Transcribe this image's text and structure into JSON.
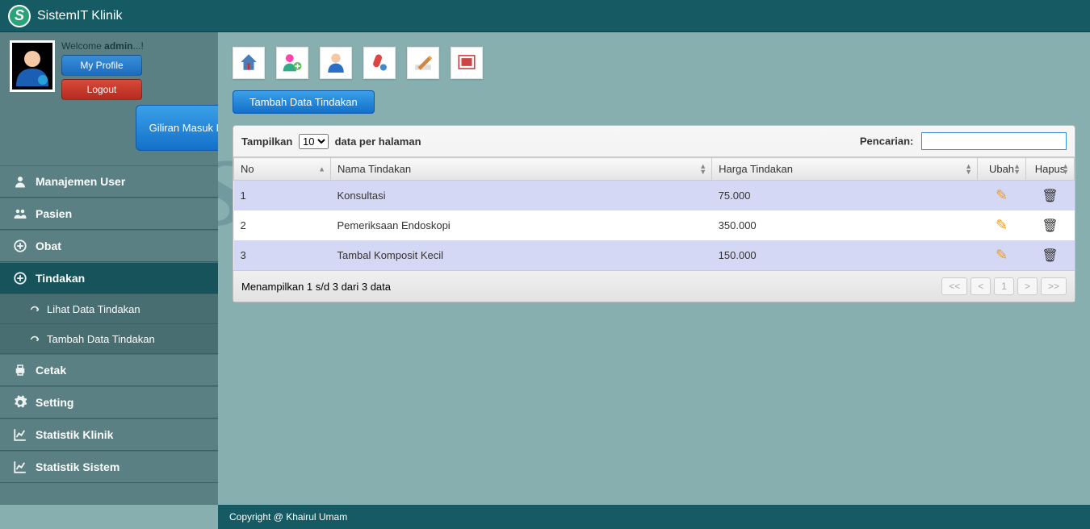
{
  "app": {
    "title": "SistemIT Klinik",
    "logo_letter": "S"
  },
  "profile": {
    "welcome_prefix": "Welcome ",
    "username": "admin",
    "welcome_suffix": "...!",
    "my_profile": "My Profile",
    "logout": "Logout",
    "queue_btn": "Giliran Masuk Pasien"
  },
  "sidebar": {
    "items": [
      {
        "label": "Manajemen User",
        "icon": "user"
      },
      {
        "label": "Pasien",
        "icon": "users"
      },
      {
        "label": "Obat",
        "icon": "plus-circle"
      },
      {
        "label": "Tindakan",
        "icon": "plus-circle",
        "active": true
      },
      {
        "label": "Lihat Data Tindakan",
        "icon": "arrow",
        "sub": true
      },
      {
        "label": "Tambah Data Tindakan",
        "icon": "arrow",
        "sub": true
      },
      {
        "label": "Cetak",
        "icon": "print"
      },
      {
        "label": "Setting",
        "icon": "gear"
      },
      {
        "label": "Statistik Klinik",
        "icon": "chart"
      },
      {
        "label": "Statistik Sistem",
        "icon": "chart"
      }
    ]
  },
  "toolbar_icons": [
    "home",
    "user-add",
    "user",
    "pills",
    "write",
    "photo"
  ],
  "main": {
    "add_button": "Tambah Data Tindakan",
    "length_prefix": "Tampilkan",
    "length_options": [
      "10"
    ],
    "length_selected": "10",
    "length_suffix": "data per halaman",
    "search_label": "Pencarian:",
    "search_value": ""
  },
  "table": {
    "columns": [
      "No",
      "Nama Tindakan",
      "Harga Tindakan",
      "Ubah",
      "Hapus"
    ],
    "rows": [
      {
        "no": "1",
        "nama": "Konsultasi",
        "harga": "75.000"
      },
      {
        "no": "2",
        "nama": "Pemeriksaan Endoskopi",
        "harga": "350.000"
      },
      {
        "no": "3",
        "nama": "Tambal Komposit Kecil",
        "harga": "150.000"
      }
    ]
  },
  "info_text": "Menampilkan 1 s/d 3 dari 3 data",
  "pager": {
    "first": "<<",
    "prev": "<",
    "page": "1",
    "next": ">",
    "last": ">>"
  },
  "watermark": "SistemIT.com",
  "footer": "Copyright @ Khairul Umam"
}
